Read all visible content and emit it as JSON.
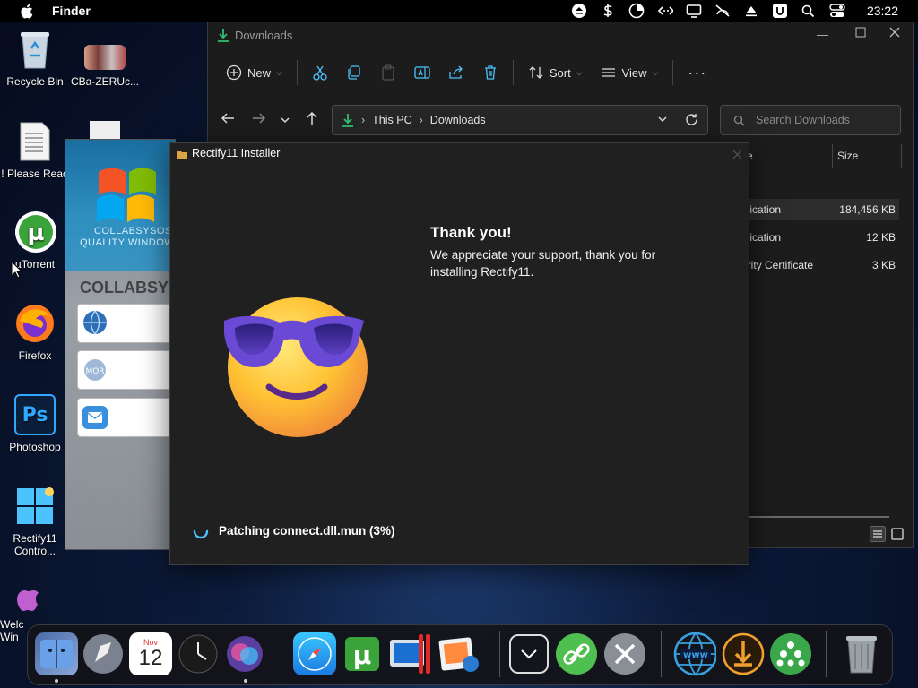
{
  "menubar": {
    "app_name": "Finder",
    "clock": "23:22"
  },
  "desktop": {
    "icons": [
      {
        "label": "Recycle Bin"
      },
      {
        "label": "CBa-ZERUc..."
      },
      {
        "label": "! Please Read"
      },
      {
        "label": "µTorrent"
      },
      {
        "label": "Firefox"
      },
      {
        "label": "Photoshop"
      },
      {
        "label": "Rectify11 Contro..."
      },
      {
        "label": "Welc Win"
      }
    ]
  },
  "explorer": {
    "title": "Downloads",
    "toolbar": {
      "new": "New",
      "sort": "Sort",
      "view": "View"
    },
    "breadcrumb": [
      "This PC",
      "Downloads"
    ],
    "search_placeholder": "Search Downloads",
    "columns": {
      "type_fragment": "e",
      "size": "Size"
    },
    "rows": [
      {
        "type": "plication",
        "size": "184,456 KB"
      },
      {
        "type": "plication",
        "size": "12 KB"
      },
      {
        "type": "urity Certificate",
        "size": "3 KB"
      }
    ]
  },
  "collab": {
    "logo_line1": "COLLABSYSOS",
    "logo_line2": "QUALITY WINDOWS",
    "heading": "COLLABSY"
  },
  "installer": {
    "title": "Rectify11 Installer",
    "heading": "Thank you!",
    "message": "We appreciate your support, thank you for installing Rectify11.",
    "status": "Patching connect.dll.mun (3%)"
  },
  "dock": {
    "calendar_month": "Nov",
    "calendar_day": "12"
  },
  "colors": {
    "accent": "#4cc2ff",
    "installer_bg": "#202020",
    "explorer_bg": "#1c1c1c"
  }
}
